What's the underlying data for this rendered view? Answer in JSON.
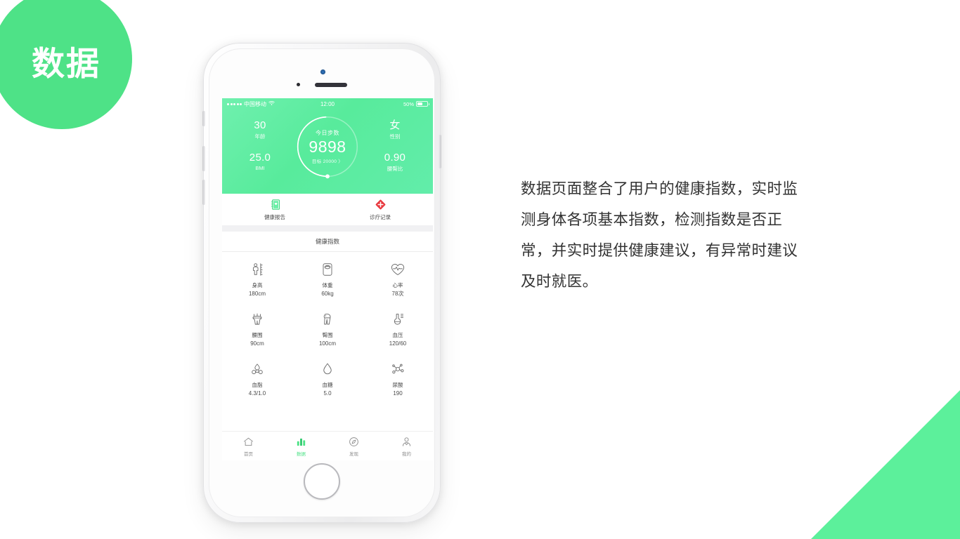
{
  "badge": {
    "text": "数据",
    "color": "#4ee287"
  },
  "description": "数据页面整合了用户的健康指数，实时监测身体各项基本指数，检测指数是否正常，并实时提供健康建议，有异常时建议及时就医。",
  "phone": {
    "status_bar": {
      "carrier": "中国移动",
      "wifi_icon": "wifi-icon",
      "time": "12:00",
      "battery_percent": "50%",
      "battery_level": 50
    },
    "header": {
      "background_color": "#58eb9c",
      "stats": [
        {
          "id": "age",
          "value": "30",
          "label": "年龄"
        },
        {
          "id": "bmi",
          "value": "25.0",
          "label": "BMI"
        },
        {
          "id": "sex",
          "value": "女",
          "label": "性别"
        },
        {
          "id": "whr",
          "value": "0.90",
          "label": "腰臀比"
        }
      ],
      "step_ring": {
        "title": "今日步数",
        "value": "9898",
        "goal": "目标 20000 〉",
        "progress_percent": 49
      }
    },
    "quick_actions": [
      {
        "id": "health-report",
        "label": "健康报告",
        "icon": "report-book-icon",
        "color": "#4ee287"
      },
      {
        "id": "medical-record",
        "label": "诊疗记录",
        "icon": "medical-cross-icon",
        "color": "#e8393f"
      }
    ],
    "section_title": "健康指数",
    "metrics": [
      [
        {
          "id": "height",
          "icon": "height-person-ruler-icon",
          "name": "身高",
          "value": "180cm"
        },
        {
          "id": "weight",
          "icon": "weight-scale-icon",
          "name": "体重",
          "value": "60kg"
        },
        {
          "id": "heart-rate",
          "icon": "heart-pulse-icon",
          "name": "心率",
          "value": "78次"
        }
      ],
      [
        {
          "id": "waist",
          "icon": "waist-measure-icon",
          "name": "腰围",
          "value": "90cm"
        },
        {
          "id": "hip",
          "icon": "hip-legs-icon",
          "name": "臀围",
          "value": "100cm"
        },
        {
          "id": "blood-pressure",
          "icon": "blood-pressure-gauge-icon",
          "name": "血压",
          "value": "120/60"
        }
      ],
      [
        {
          "id": "blood-lipids",
          "icon": "lipid-molecule-icon",
          "name": "血脂",
          "value": "4.3/1.0"
        },
        {
          "id": "blood-sugar",
          "icon": "blood-drop-icon",
          "name": "血糖",
          "value": "5.0"
        },
        {
          "id": "uric-acid",
          "icon": "uric-acid-molecule-icon",
          "name": "尿酸",
          "value": "190"
        }
      ]
    ],
    "tabs": [
      {
        "id": "home",
        "label": "首页",
        "icon": "home-icon",
        "active": false
      },
      {
        "id": "data",
        "label": "数据",
        "icon": "bar-chart-icon",
        "active": true
      },
      {
        "id": "discover",
        "label": "发现",
        "icon": "compass-icon",
        "active": false
      },
      {
        "id": "mine",
        "label": "我的",
        "icon": "person-icon",
        "active": false
      }
    ]
  }
}
